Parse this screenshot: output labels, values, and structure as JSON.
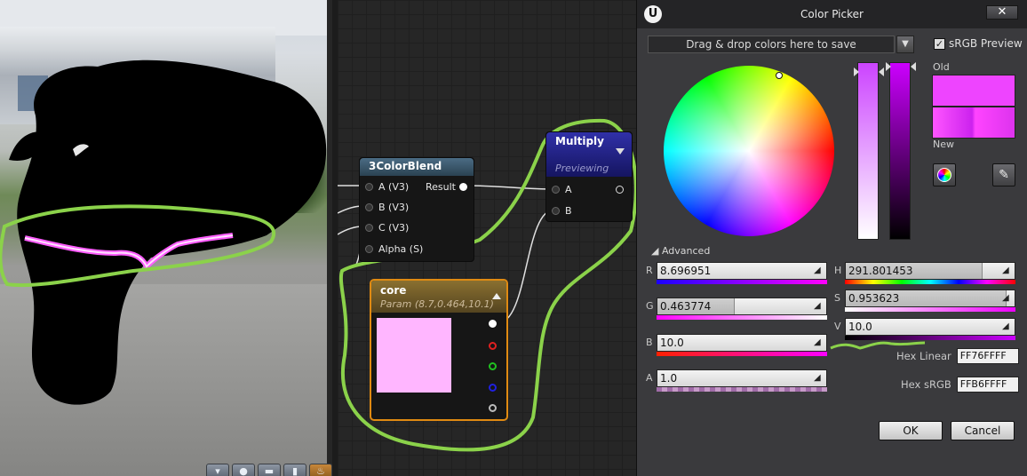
{
  "viewport": {
    "toolbar_icons": [
      "view-mode-icon",
      "sphere-icon",
      "plane-icon",
      "cylinder-icon",
      "teapot-icon"
    ]
  },
  "graph": {
    "node_blend": {
      "title": "3ColorBlend",
      "inputs": [
        "A (V3)",
        "B (V3)",
        "C (V3)",
        "Alpha (S)"
      ],
      "output": "Result"
    },
    "node_multiply": {
      "title": "Multiply",
      "subtitle": "Previewing",
      "inputs": [
        "A",
        "B"
      ]
    },
    "node_core": {
      "title": "core",
      "subtitle": "Param (8.7,0.464,10.1)",
      "swatch_color": "#ffb6ff",
      "pin_colors": [
        "#ffffff",
        "#e02020",
        "#20c020",
        "#2020e0",
        "#bbbbbb"
      ]
    }
  },
  "dialog": {
    "title": "Color Picker",
    "close_label": "✕",
    "dropzone_text": "Drag & drop colors here to save",
    "srgb_label": "sRGB Preview",
    "srgb_checked": true,
    "old_label": "Old",
    "new_label": "New",
    "old_color": "#ee44ff",
    "advanced_label": "Advanced",
    "fields_left": [
      {
        "label": "R",
        "value": "8.696951"
      },
      {
        "label": "G",
        "value": "0.463774"
      },
      {
        "label": "B",
        "value": "10.0"
      },
      {
        "label": "A",
        "value": "1.0"
      }
    ],
    "fields_right": [
      {
        "label": "H",
        "value": "291.801453"
      },
      {
        "label": "S",
        "value": "0.953623"
      },
      {
        "label": "V",
        "value": "10.0"
      }
    ],
    "hex_linear_label": "Hex Linear",
    "hex_linear_value": "FF76FFFF",
    "hex_srgb_label": "Hex sRGB",
    "hex_srgb_value": "FFB6FFFF",
    "ok_label": "OK",
    "cancel_label": "Cancel"
  }
}
